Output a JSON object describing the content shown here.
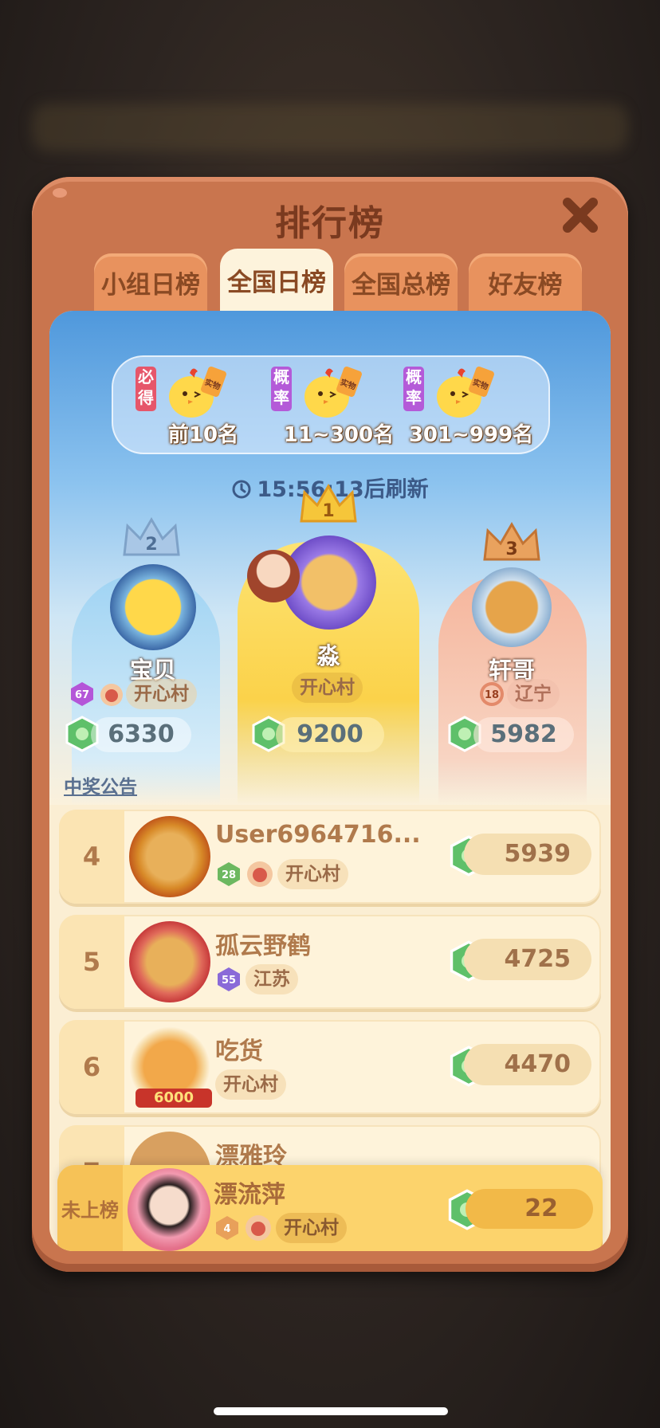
{
  "title": "排行榜",
  "tabs": [
    {
      "label": "小组日榜",
      "active": false
    },
    {
      "label": "全国日榜",
      "active": true
    },
    {
      "label": "全国总榜",
      "active": false
    },
    {
      "label": "好友榜",
      "active": false
    }
  ],
  "prizes": [
    {
      "tag": "必得",
      "tag_color": "#e6566a",
      "label": "实物",
      "range": "前10名"
    },
    {
      "tag": "概率",
      "tag_color": "#b45ad8",
      "label": "实物",
      "range": "11~300名"
    },
    {
      "tag": "概率",
      "tag_color": "#b45ad8",
      "label": "实物",
      "range": "301~999名"
    }
  ],
  "refresh_text": "15:56:13后刷新",
  "podium": [
    {
      "rank": "2",
      "name": "宝贝",
      "level": "67",
      "village": "开心村",
      "score": "6330"
    },
    {
      "rank": "1",
      "name": "淼",
      "village": "开心村",
      "score": "9200"
    },
    {
      "rank": "3",
      "name": "轩哥",
      "level": "18",
      "village": "辽宁",
      "score": "5982"
    }
  ],
  "notice_link": "中奖公告",
  "list": [
    {
      "rank": "4",
      "name": "User6964716...",
      "level": "28",
      "village": "开心村",
      "score": "5939"
    },
    {
      "rank": "5",
      "name": "孤云野鹤",
      "level": "55",
      "village": "江苏",
      "score": "4725"
    },
    {
      "rank": "6",
      "name": "吃货",
      "village": "开心村",
      "score": "4470",
      "avatar_badge": "6000"
    },
    {
      "rank": "7",
      "name": "漂雅玲"
    }
  ],
  "me": {
    "rank_label": "未上榜",
    "name": "漂流萍",
    "level": "4",
    "village": "开心村",
    "score": "22"
  },
  "colors": {
    "modal": "#c9754e",
    "accent_brown": "#7a3a1f",
    "gold": "#fcd36c"
  },
  "icons": [
    "close-icon",
    "clock-icon",
    "chick-icon",
    "crown-icon",
    "gem-icon",
    "level-badge-icon",
    "village-badge-icon"
  ]
}
